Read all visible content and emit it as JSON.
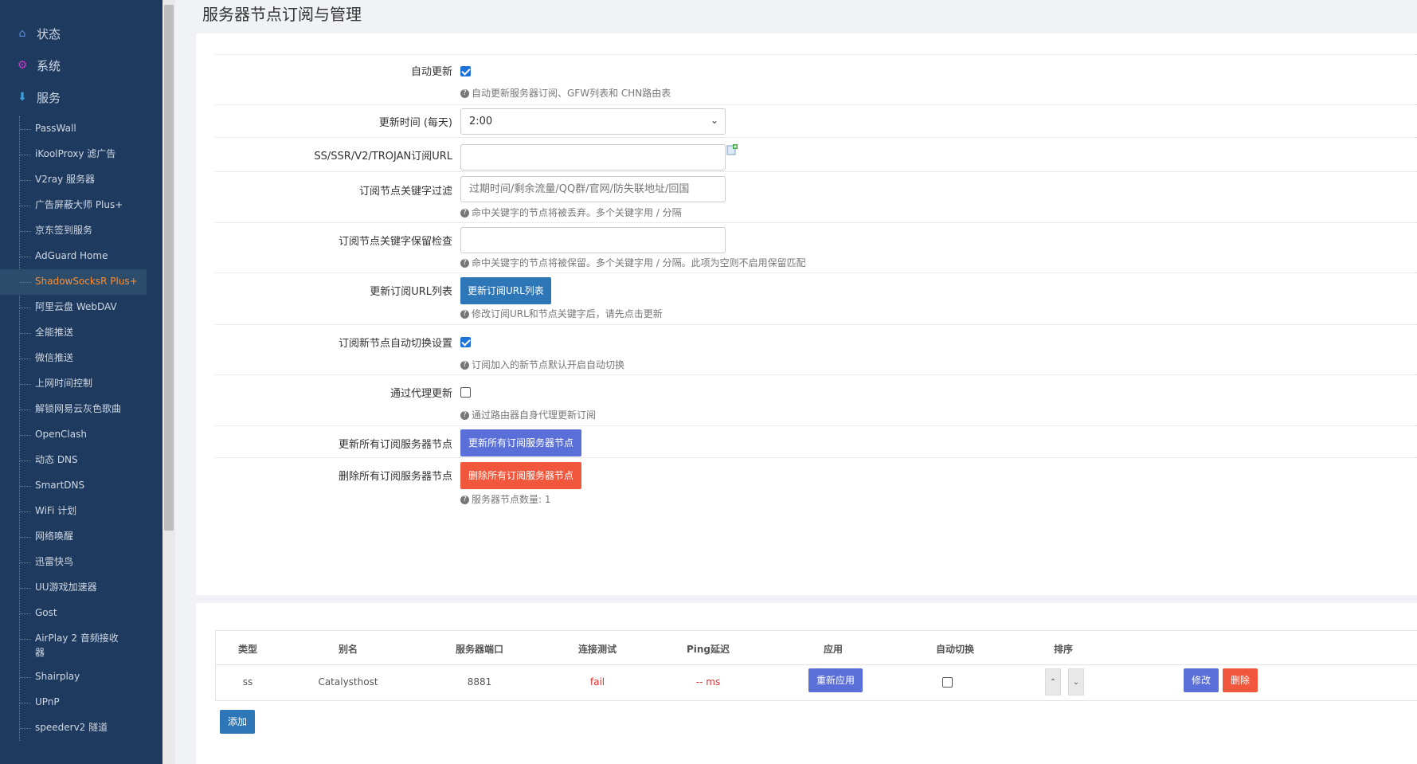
{
  "sidebar": {
    "top": [
      {
        "icon": "home-icon",
        "label": "状态"
      },
      {
        "icon": "gear-icon",
        "label": "系统"
      },
      {
        "icon": "services-icon",
        "label": "服务"
      }
    ],
    "items": [
      "PassWall",
      "iKoolProxy 滤广告",
      "V2ray 服务器",
      "广告屏蔽大师 Plus+",
      "京东签到服务",
      "AdGuard Home",
      "ShadowSocksR Plus+",
      "阿里云盘 WebDAV",
      "全能推送",
      "微信推送",
      "上网时间控制",
      "解锁网易云灰色歌曲",
      "OpenClash",
      "动态 DNS",
      "SmartDNS",
      "WiFi 计划",
      "网络唤醒",
      "迅雷快鸟",
      "UU游戏加速器",
      "Gost",
      "AirPlay 2 音频接收器",
      "Shairplay",
      "UPnP",
      "speederv2 隧道"
    ],
    "active_index": 6
  },
  "page": {
    "title": "服务器节点订阅与管理"
  },
  "form": {
    "auto_update": {
      "label": "自动更新",
      "checked": true,
      "hint": "自动更新服务器订阅、GFW列表和 CHN路由表"
    },
    "update_time": {
      "label": "更新时间 (每天)",
      "value": "2:00"
    },
    "sub_url": {
      "label": "SS/SSR/V2/TROJAN订阅URL",
      "value": ""
    },
    "filter_words": {
      "label": "订阅节点关键字过滤",
      "placeholder": "过期时间/剩余流量/QQ群/官网/防失联地址/回国",
      "hint": "命中关键字的节点将被丢弃。多个关键字用 / 分隔"
    },
    "keep_words": {
      "label": "订阅节点关键字保留检查",
      "value": "",
      "hint": "命中关键字的节点将被保留。多个关键字用 / 分隔。此项为空则不启用保留匹配"
    },
    "update_url_list": {
      "label": "更新订阅URL列表",
      "button": "更新订阅URL列表",
      "hint": "修改订阅URL和节点关键字后，请先点击更新"
    },
    "auto_switch": {
      "label": "订阅新节点自动切换设置",
      "checked": true,
      "hint": "订阅加入的新节点默认开启自动切换"
    },
    "via_proxy": {
      "label": "通过代理更新",
      "checked": false,
      "hint": "通过路由器自身代理更新订阅"
    },
    "update_all": {
      "label": "更新所有订阅服务器节点",
      "button": "更新所有订阅服务器节点"
    },
    "delete_all": {
      "label": "删除所有订阅服务器节点",
      "button": "删除所有订阅服务器节点",
      "hint": "服务器节点数量: 1"
    }
  },
  "table": {
    "headers": [
      "类型",
      "别名",
      "服务器端口",
      "连接测试",
      "Ping延迟",
      "应用",
      "自动切换",
      "排序"
    ],
    "rows": [
      {
        "type": "ss",
        "alias": "Catalysthost",
        "port": "8881",
        "test": "fail",
        "ping": "-- ms",
        "apply": "重新应用",
        "auto_switch": false,
        "edit": "修改",
        "delete": "删除"
      }
    ],
    "add_button": "添加"
  },
  "colors": {
    "sidebar": "#1f3a5f",
    "active": "#ff8c2e",
    "primary": "#2d77b8",
    "indigo": "#5b6fd8",
    "danger": "#f0573c"
  }
}
